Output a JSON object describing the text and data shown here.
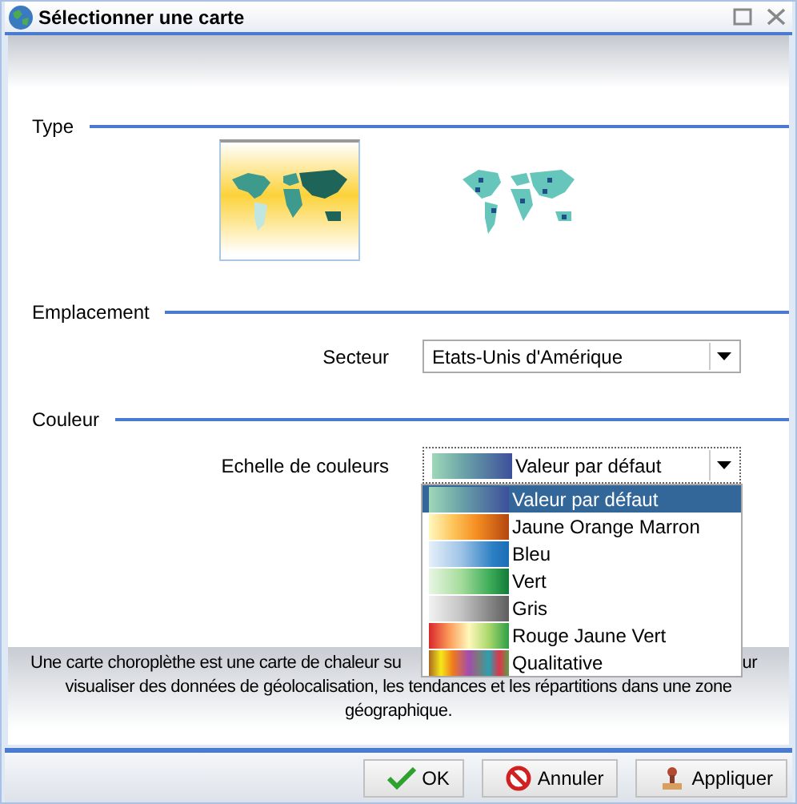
{
  "window": {
    "title": "Sélectionner une carte"
  },
  "type": {
    "label": "Type",
    "options": [
      {
        "kind": "choropleth",
        "selected": true
      },
      {
        "kind": "points",
        "selected": false
      }
    ]
  },
  "location": {
    "label": "Emplacement",
    "field_label": "Secteur",
    "value": "Etats-Unis d'Amérique"
  },
  "color": {
    "label": "Couleur",
    "field_label": "Echelle de couleurs",
    "value": {
      "text": "Valeur par défaut",
      "kind": "default"
    },
    "expanded": true,
    "options": [
      {
        "text": "Valeur par défaut",
        "kind": "default",
        "selected": true
      },
      {
        "text": "Jaune Orange Marron",
        "kind": "ylorbr",
        "selected": false
      },
      {
        "text": "Bleu",
        "kind": "blue",
        "selected": false
      },
      {
        "text": "Vert",
        "kind": "green",
        "selected": false
      },
      {
        "text": "Gris",
        "kind": "gray",
        "selected": false
      },
      {
        "text": "Rouge Jaune Vert",
        "kind": "rdylgn",
        "selected": false
      },
      {
        "text": "Qualitative",
        "kind": "qualitative",
        "selected": false
      }
    ]
  },
  "description": {
    "line_1_start": "Une carte choroplèthe est une carte de chaleur su",
    "line_1_end": "ur",
    "line_2": "visualiser des données de géolocalisation, les tendances et les répartitions dans une zone",
    "line_3": "géographique."
  },
  "buttons": [
    {
      "label": "OK",
      "kind": "ok"
    },
    {
      "label": "Annuler",
      "kind": "cancel"
    },
    {
      "label": "Appliquer",
      "kind": "apply"
    }
  ]
}
